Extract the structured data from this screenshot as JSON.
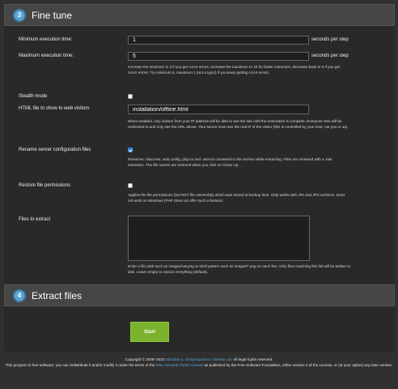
{
  "fine_tune": {
    "step": "3",
    "title": "Fine tune",
    "min_exec_label": "Minimum execution time:",
    "min_exec_value": "1",
    "min_exec_unit": "seconds per step",
    "max_exec_label": "Maximum execution time:",
    "max_exec_value": "5",
    "max_exec_unit": "seconds per step",
    "exec_help": "Increase the minimum to 3 if you get AJAX errors. Increase the maximum to 10 for faster extraction, decrease back to 5 if you get AJAX errors. Try minimum 5, maximum 1 (not a typo!) if you keep getting AJAX errors.",
    "stealth_label": "Stealth mode",
    "stealth_checked": false,
    "html_file_label": "HTML file to show to web visitors",
    "html_file_value": "installation/offline.html",
    "stealth_help": "When enabled, only visitors from your IP address will be able to see the site until the restoration is complete. Everyone else will be redirected to and only see the URL above. Your server must see the real IP of the visitor (this is controlled by your host, not you or us).",
    "rename_label": "Rename server configuration files",
    "rename_checked": true,
    "rename_help": "Renames .htaccess, web.config, php.ini and .user.ini contained in the archive while extracting. Files are renamed with a .bak extension. The file names are restored when you click on Clean Up.",
    "restore_label": "Restore file permissions",
    "restore_checked": false,
    "restore_help": "Applies the file permissions (but NOT file ownership) which was stored at backup time. Only works with JPA and JPS archives. Does not work on Windows (PHP does not offer such a feature).",
    "files_label": "Files to extract",
    "files_value": "",
    "files_help": "Enter a file path such as images/cat.png or shell pattern such as images/*.png on each line. Only files matching this list will be written to disk. Leave empty to extract everything (default)."
  },
  "extract": {
    "step": "4",
    "title": "Extract files",
    "start_label": "Start"
  },
  "footer": {
    "line1_prefix": "Copyright © 2008–2023 ",
    "author_link": "Nicholas K. Dionysopoulos / Akeeba Ltd",
    "line1_suffix": ". All legal rights reserved.",
    "line2_prefix": "This program is free software: you can redistribute it and/or modify it under the terms of the ",
    "license_link": "GNU General Public License",
    "line2_suffix": " as published by the Free Software Foundation, either version 3 of the License, or (at your option) any later version."
  },
  "colors": {
    "accent": "#5aa5d6",
    "start_button": "#7bb32e",
    "checkbox_checked": "#2f7fd6"
  }
}
